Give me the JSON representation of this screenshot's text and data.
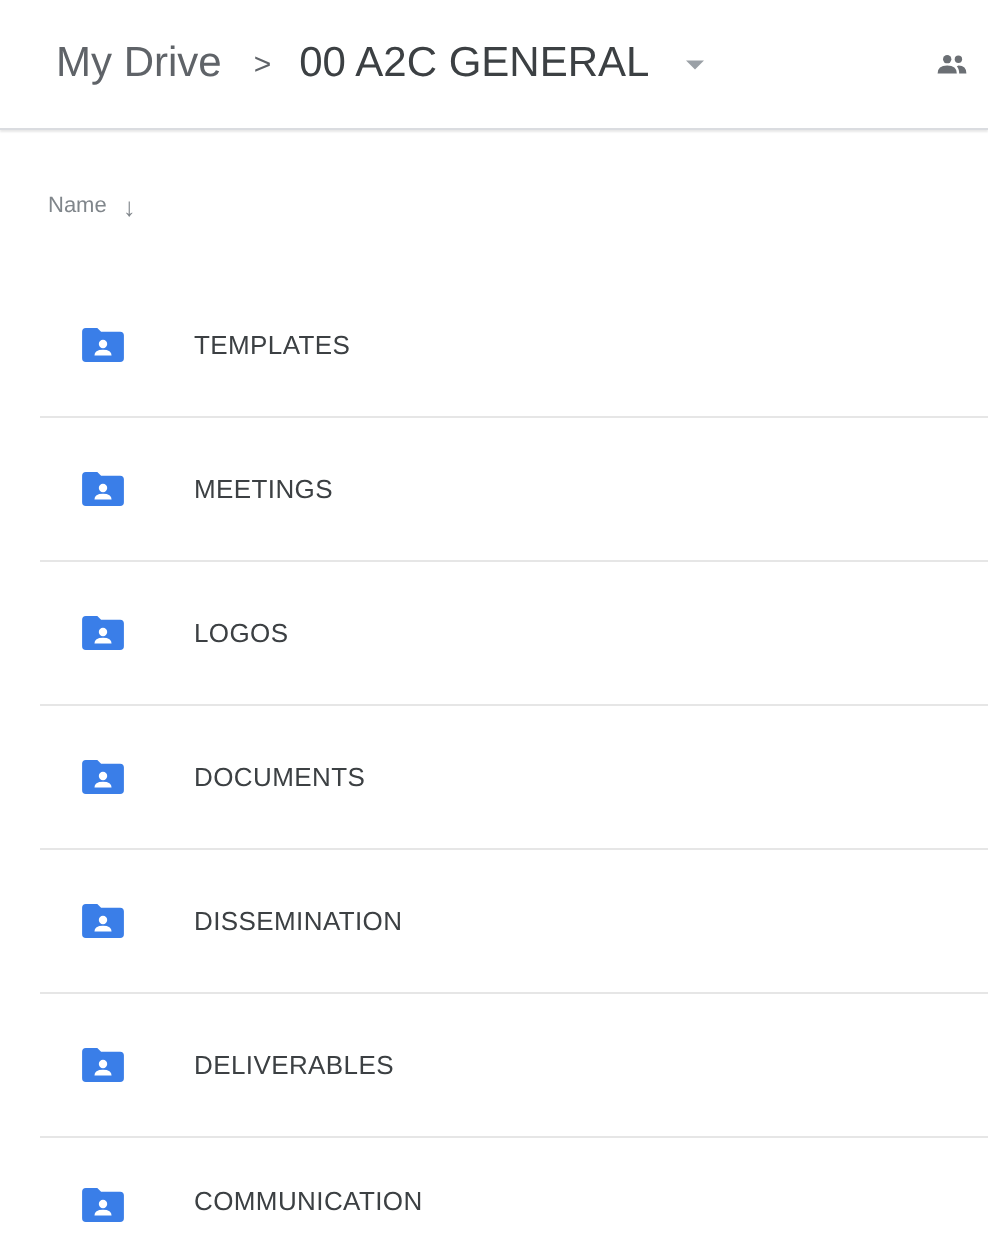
{
  "breadcrumb": {
    "root": "My Drive",
    "separator": ">",
    "current": "00 A2C GENERAL"
  },
  "list_header": {
    "label": "Name",
    "sort_arrow": "↓"
  },
  "folders": [
    {
      "name": "TEMPLATES",
      "kind": "shared-folder"
    },
    {
      "name": "MEETINGS",
      "kind": "shared-folder"
    },
    {
      "name": "LOGOS",
      "kind": "shared-folder"
    },
    {
      "name": "DOCUMENTS",
      "kind": "shared-folder"
    },
    {
      "name": "DISSEMINATION",
      "kind": "shared-folder"
    },
    {
      "name": "DELIVERABLES",
      "kind": "shared-folder"
    },
    {
      "name": "COMMUNICATION",
      "kind": "shared-folder"
    }
  ]
}
